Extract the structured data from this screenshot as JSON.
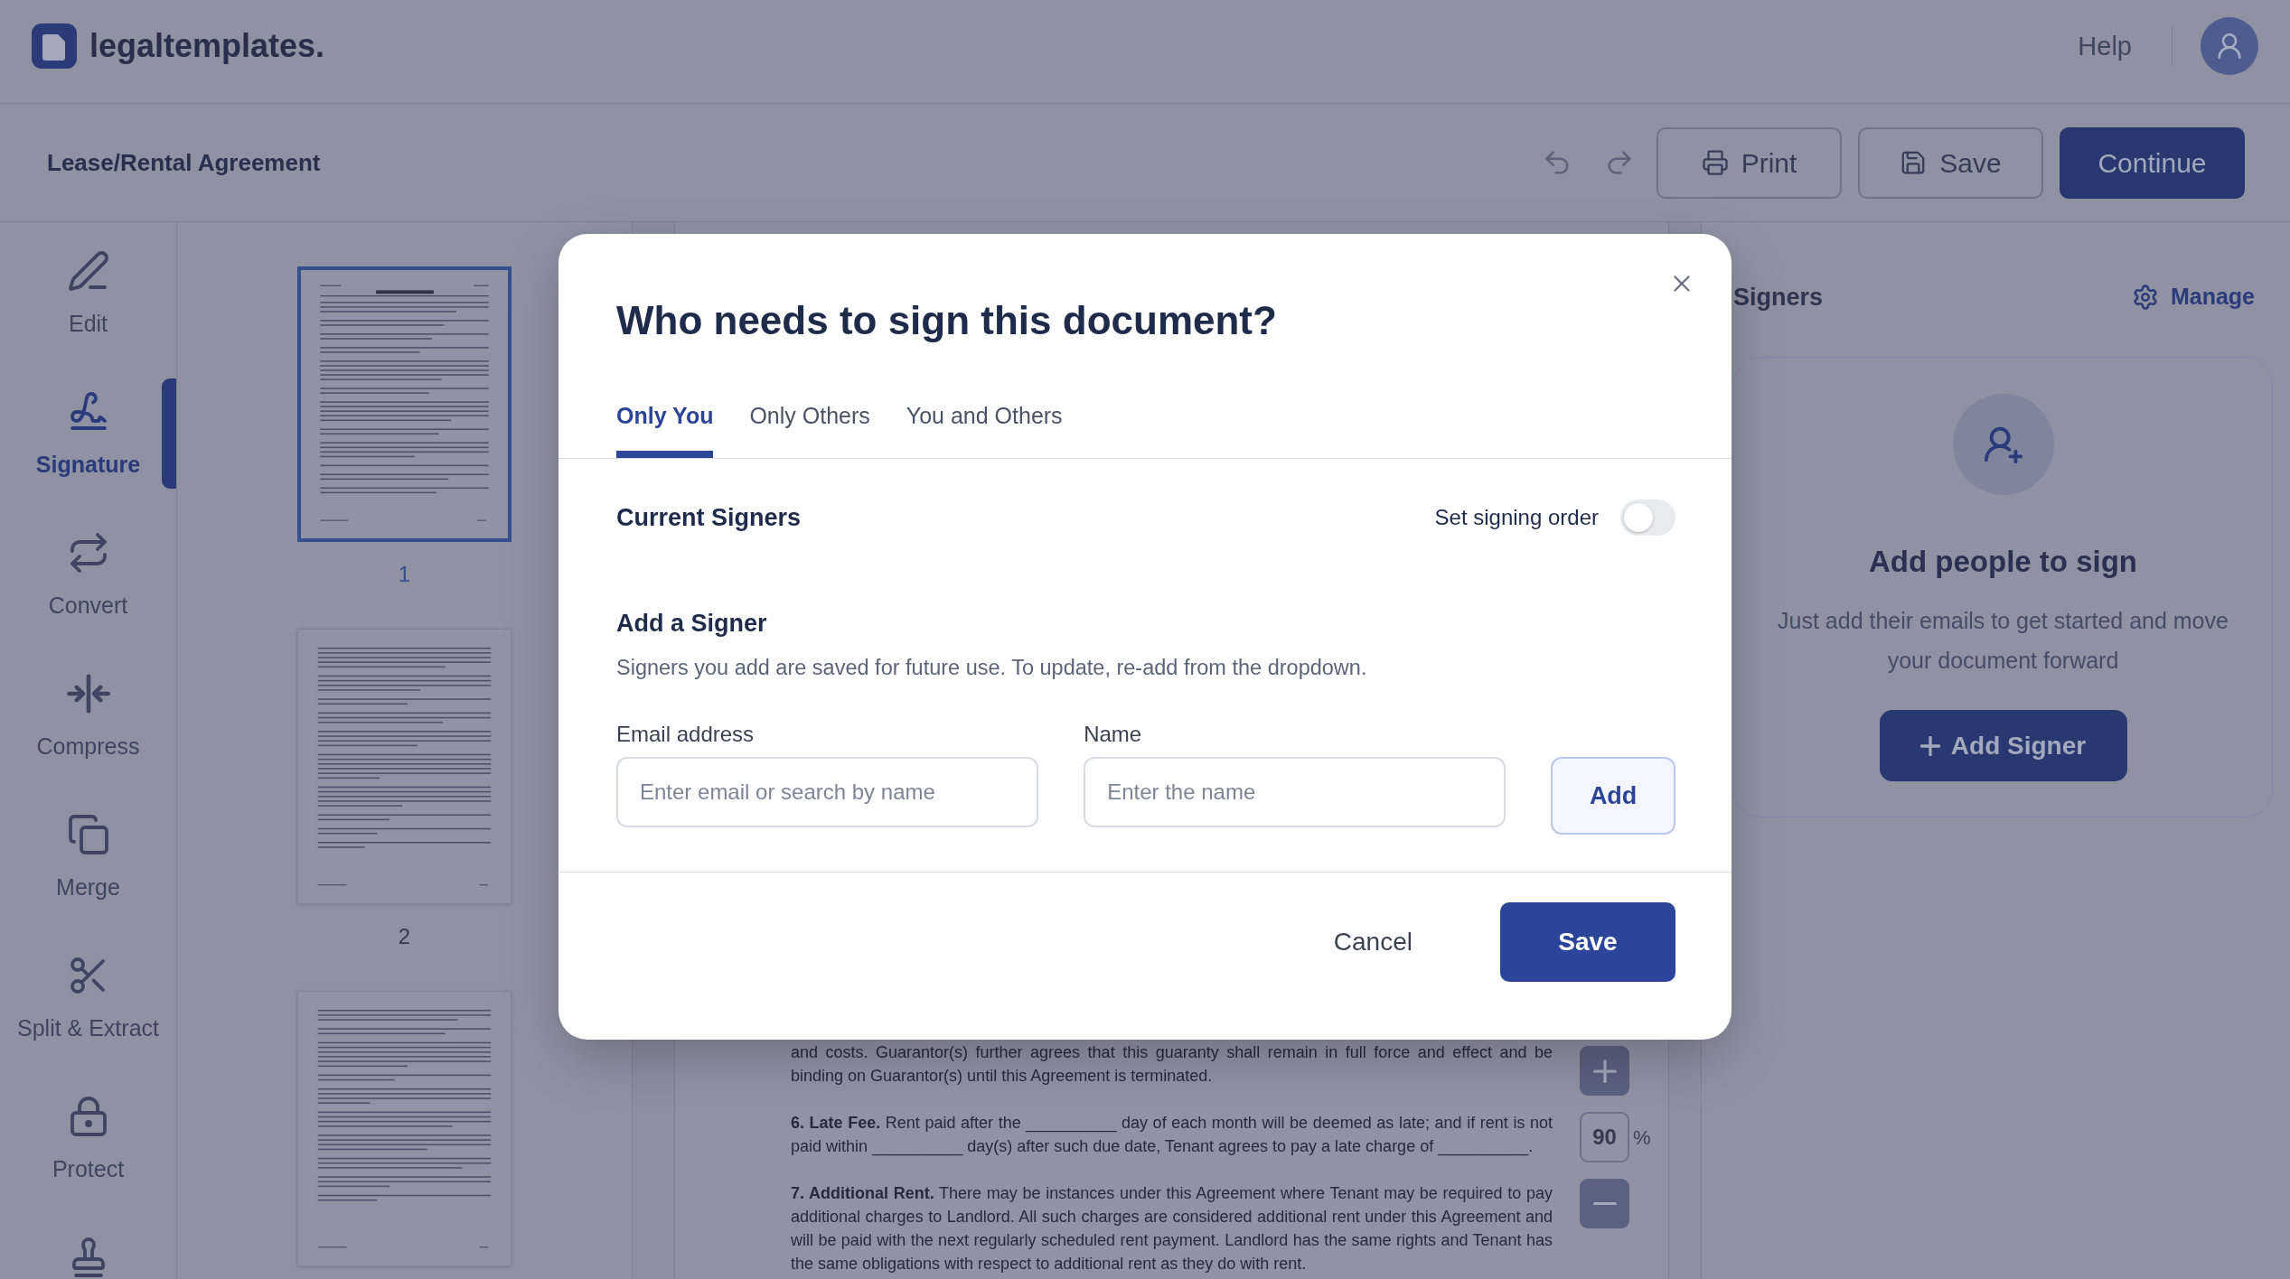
{
  "header": {
    "brand": "legaltemplates.",
    "help": "Help"
  },
  "toolbar": {
    "document_title": "Lease/Rental Agreement",
    "buttons": [
      {
        "label": "Print",
        "kind": "outline"
      },
      {
        "label": "Save",
        "kind": "outline"
      },
      {
        "label": "Continue",
        "kind": "primary"
      }
    ]
  },
  "sidebar": {
    "items": [
      {
        "label": "Edit",
        "selected": false
      },
      {
        "label": "Signature",
        "selected": true
      },
      {
        "label": "Convert",
        "selected": false
      },
      {
        "label": "Compress",
        "selected": false
      },
      {
        "label": "Merge",
        "selected": false
      },
      {
        "label": "Split & Extract",
        "selected": false
      },
      {
        "label": "Protect",
        "selected": false
      },
      {
        "selected": false
      }
    ]
  },
  "thumbnails": [
    {
      "page_number": "1",
      "selected": true
    },
    {
      "page_number": "2",
      "selected": false
    },
    {
      "selected": false
    }
  ],
  "document": {
    "paragraphs": [
      "and costs. Guarantor(s) further agrees that this guaranty shall remain in full force and effect and be binding on Guarantor(s) until this Agreement is terminated.",
      "**6. Late Fee.** Rent paid after the __________ day of each month will be deemed as late; and if rent is not paid within __________ day(s) after such due date, Tenant agrees to pay a late charge of __________.",
      "**7. Additional Rent.** There may be instances under this Agreement where Tenant may be required to pay additional charges to Landlord. All such charges are considered additional rent under this Agreement and will be paid with the next regularly scheduled rent payment. Landlord has the same rights and Tenant has the same obligations with respect to additional rent as they do with rent."
    ]
  },
  "zoom": {
    "value": "90",
    "unit": "%"
  },
  "signers_panel": {
    "title": "Signers",
    "manage": "Manage",
    "empty_title": "Add people to sign",
    "empty_text": "Just add their emails to get started and move your document forward",
    "add_button": "Add Signer"
  },
  "dialog": {
    "title": "Who needs to sign this document?",
    "tabs": [
      {
        "label": "Only You",
        "selected": true
      },
      {
        "label": "Only Others",
        "selected": false
      },
      {
        "label": "You and Others",
        "selected": false
      }
    ],
    "current_signers": "Current Signers",
    "signing_order": {
      "label": "Set signing order",
      "on": false
    },
    "add_signer": {
      "title": "Add a Signer",
      "description": "Signers you add are saved for future use. To update, re-add from the dropdown.",
      "fields": [
        {
          "label": "Email address",
          "placeholder": "Enter email or search by name"
        },
        {
          "label": "Name",
          "placeholder": "Enter the name"
        }
      ],
      "add_button": "Add"
    },
    "buttons": [
      {
        "label": "Cancel",
        "kind": "secondary"
      },
      {
        "label": "Save",
        "kind": "primary"
      }
    ]
  }
}
